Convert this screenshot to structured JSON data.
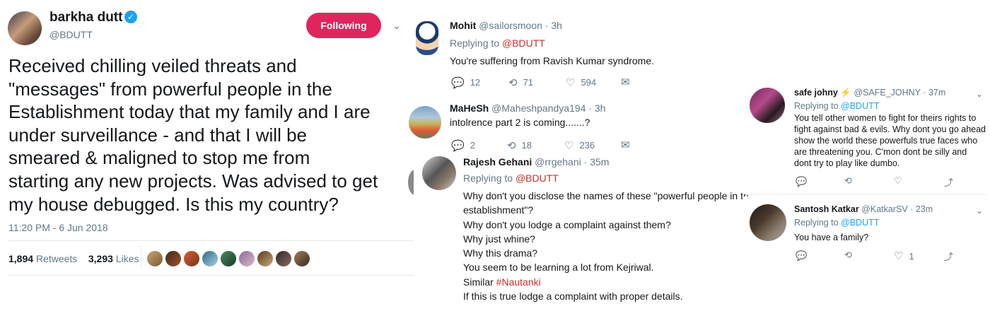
{
  "main_tweet": {
    "author_name": "barkha dutt",
    "author_handle": "@BDUTT",
    "follow_label": "Following",
    "text": "Received chilling veiled threats and \"messages\" from powerful people in the Establishment today that my family and I are under surveillance - and that I will be smeared & maligned to stop me from starting any new projects. Was advised to get my house debugged. Is this my country?",
    "text_lines": [
      "Received chilling veiled threats and",
      "\"messages\" from powerful people in the",
      "Establishment today that my family and I are",
      "under surveillance - and that I will be",
      "smeared & maligned to stop me from",
      "starting any new projects. Was advised to get",
      "my house debugged. Is this my country?"
    ],
    "timestamp": "11:20 PM - 6 Jun 2018",
    "retweets_count": "1,894",
    "retweets_label": "Retweets",
    "likes_count": "3,293",
    "likes_label": "Likes"
  },
  "replies": [
    {
      "name": "Mohit",
      "handle": "@sailorsmoon",
      "time": "3h",
      "replying_prefix": "Replying to",
      "replying_to": "@BDUTT",
      "lines": [
        "You're suffering from Ravish Kumar syndrome."
      ],
      "reply_count": "12",
      "retweet_count": "71",
      "like_count": "594"
    },
    {
      "name": "MaHeSh",
      "handle": "@Maheshpandya194",
      "time": "3h",
      "lines": [
        "intolrence part 2 is coming.......?"
      ],
      "reply_count": "2",
      "retweet_count": "18",
      "like_count": "236"
    },
    {
      "name": "Rajesh Gehani",
      "handle": "@rrgehani",
      "time": "35m",
      "replying_prefix": "Replying to",
      "replying_to": "@BDUTT",
      "lines": [
        "Why don't you disclose the names of these \"powerful people in th",
        "establishment\"?",
        "Why don't you lodge a complaint against them?",
        "Why just whine?",
        "Why this drama?",
        "You seem to be learning a lot from Kejriwal.",
        "Similar",
        "If this is true lodge a complaint with proper details."
      ],
      "hashtag": "#Nautanki"
    },
    {
      "name": "safe johny",
      "emoji": "⚡",
      "handle": "@SAFE_JOHNY",
      "time": "37m",
      "replying_prefix": "Replying to",
      "replying_to": "@BDUTT",
      "lines": [
        "You tell other women to fight for theirs rights to",
        "fight against bad & evils. Why dont you go ahead",
        "show the world these powerfuls true faces who",
        "are threatening you. C'mon dont be silly and",
        "dont try to play like dumbo."
      ]
    },
    {
      "name": "Santosh Katkar",
      "handle": "@KatkarSV",
      "time": "23m",
      "replying_prefix": "Replying to",
      "replying_to": "@BDUTT",
      "lines": [
        "You have a family?"
      ],
      "like_count": "1"
    }
  ],
  "colors": {
    "follow_button": "#e0245e",
    "mention": "#c4302b",
    "verified": "#1da1f2",
    "thread_line": "#f0a8a8"
  }
}
